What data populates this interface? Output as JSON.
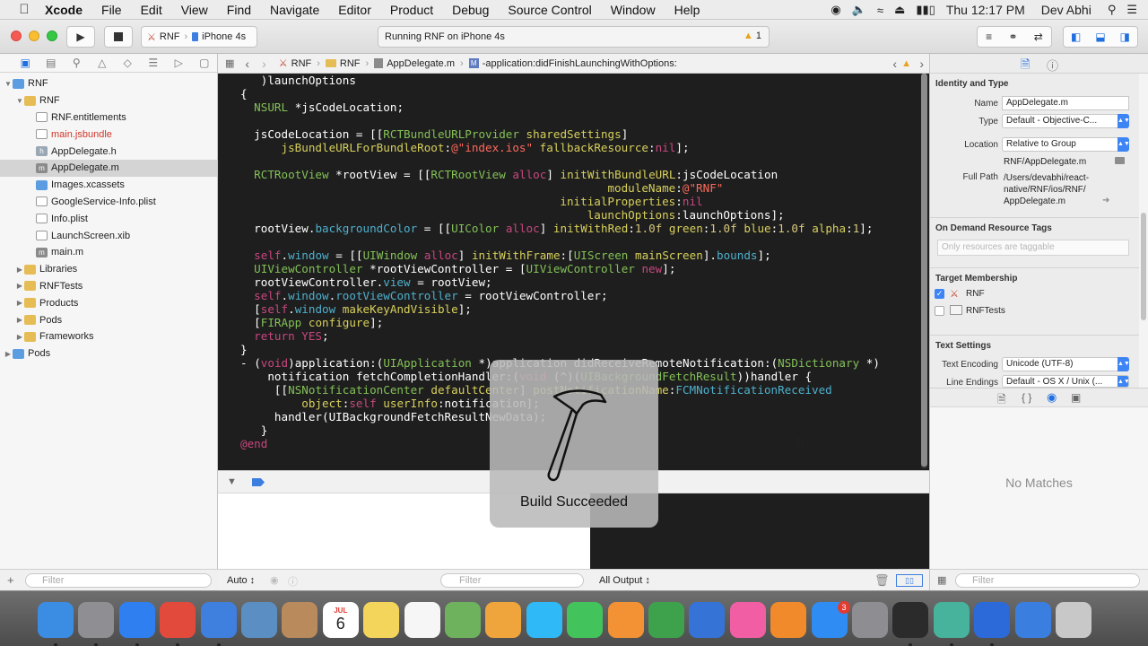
{
  "menubar": {
    "app": "Xcode",
    "items": [
      "File",
      "Edit",
      "View",
      "Find",
      "Navigate",
      "Editor",
      "Product",
      "Debug",
      "Source Control",
      "Window",
      "Help"
    ],
    "clock": "Thu 12:17 PM",
    "user": "Dev Abhi"
  },
  "toolbar": {
    "scheme": "RNF",
    "device": "iPhone 4s",
    "activity": "Running RNF on iPhone 4s",
    "warning_count": "1"
  },
  "navigator": {
    "items": [
      {
        "label": "RNF",
        "depth": 0,
        "icon": "project-icon",
        "expanded": true
      },
      {
        "label": "RNF",
        "depth": 1,
        "icon": "folder-icon",
        "expanded": true
      },
      {
        "label": "RNF.entitlements",
        "depth": 2,
        "icon": "entitlements-file-icon"
      },
      {
        "label": "main.jsbundle",
        "depth": 2,
        "icon": "file-icon",
        "missing": true
      },
      {
        "label": "AppDelegate.h",
        "depth": 2,
        "icon": "header-file-icon"
      },
      {
        "label": "AppDelegate.m",
        "depth": 2,
        "icon": "objc-file-icon",
        "selected": true
      },
      {
        "label": "Images.xcassets",
        "depth": 2,
        "icon": "asset-catalog-icon"
      },
      {
        "label": "GoogleService-Info.plist",
        "depth": 2,
        "icon": "plist-file-icon"
      },
      {
        "label": "Info.plist",
        "depth": 2,
        "icon": "plist-file-icon"
      },
      {
        "label": "LaunchScreen.xib",
        "depth": 2,
        "icon": "xib-file-icon"
      },
      {
        "label": "main.m",
        "depth": 2,
        "icon": "objc-file-icon"
      },
      {
        "label": "Libraries",
        "depth": 1,
        "icon": "folder-icon"
      },
      {
        "label": "RNFTests",
        "depth": 1,
        "icon": "folder-icon"
      },
      {
        "label": "Products",
        "depth": 1,
        "icon": "folder-icon"
      },
      {
        "label": "Pods",
        "depth": 1,
        "icon": "folder-icon"
      },
      {
        "label": "Frameworks",
        "depth": 1,
        "icon": "folder-icon"
      },
      {
        "label": "Pods",
        "depth": 0,
        "icon": "project-icon"
      }
    ],
    "filter_placeholder": "Filter"
  },
  "jumpbar": {
    "segments": [
      "RNF",
      "RNF",
      "AppDelegate.m",
      "-application:didFinishLaunchingWithOptions:"
    ]
  },
  "editor": {
    "lines": [
      "   )launchOptions",
      "{",
      "  NSURL *jsCodeLocation;",
      "",
      "  jsCodeLocation = [[RCTBundleURLProvider sharedSettings]",
      "      jsBundleURLForBundleRoot:@\"index.ios\" fallbackResource:nil];",
      "",
      "  RCTRootView *rootView = [[RCTRootView alloc] initWithBundleURL:jsCodeLocation",
      "                                                      moduleName:@\"RNF\"",
      "                                               initialProperties:nil",
      "                                                   launchOptions:launchOptions];",
      "  rootView.backgroundColor = [[UIColor alloc] initWithRed:1.0f green:1.0f blue:1.0f alpha:1];",
      "",
      "  self.window = [[UIWindow alloc] initWithFrame:[UIScreen mainScreen].bounds];",
      "  UIViewController *rootViewController = [UIViewController new];",
      "  rootViewController.view = rootView;",
      "  self.window.rootViewController = rootViewController;",
      "  [self.window makeKeyAndVisible];",
      "  [FIRApp configure];",
      "  return YES;",
      "}",
      "- (void)application:(UIApplication *)application didReceiveRemoteNotification:(NSDictionary *)",
      "    notification fetchCompletionHandler:(void (^)(UIBackgroundFetchResult))handler {",
      "     [[NSNotificationCenter defaultCenter] postNotificationName:FCMNotificationReceived",
      "         object:self userInfo:notification];",
      "     handler(UIBackgroundFetchResultNewData);",
      "   }",
      "@end"
    ]
  },
  "debug": {
    "auto_label": "Auto ↕",
    "filter_placeholder": "Filter",
    "output_label": "All Output ↕"
  },
  "inspector": {
    "identity_title": "Identity and Type",
    "name_label": "Name",
    "name_value": "AppDelegate.m",
    "type_label": "Type",
    "type_value": "Default - Objective-C...",
    "location_label": "Location",
    "location_value": "Relative to Group",
    "location_path": "RNF/AppDelegate.m",
    "fullpath_label": "Full Path",
    "fullpath_lines": [
      "/Users/devabhi/react-",
      "native/RNF/ios/RNF/",
      "AppDelegate.m"
    ],
    "ondemand_title": "On Demand Resource Tags",
    "ondemand_placeholder": "Only resources are taggable",
    "membership_title": "Target Membership",
    "targets": [
      {
        "name": "RNF",
        "checked": true
      },
      {
        "name": "RNFTests",
        "checked": false
      }
    ],
    "textsettings_title": "Text Settings",
    "encoding_label": "Text Encoding",
    "encoding_value": "Unicode (UTF-8)",
    "lineendings_label": "Line Endings",
    "lineendings_value": "Default - OS X / Unix (...",
    "no_matches": "No Matches",
    "filter_placeholder": "Filter"
  },
  "hud": {
    "message": "Build Succeeded"
  },
  "dock": {
    "apps": [
      "Finder",
      "Launchpad",
      "Safari",
      "Chrome",
      "Xcode",
      "Preview",
      "Contacts",
      "Calendar",
      "Notes",
      "Reminders",
      "Maps",
      "Photos",
      "Messages",
      "FaceTime",
      "Pages",
      "Numbers",
      "Keynote",
      "iTunes",
      "iBooks",
      "App Store",
      "System Preferences",
      "Terminal",
      "Atom",
      "QuickTime",
      "Xcode Tool",
      "Trash"
    ],
    "calendar_month": "JUL",
    "calendar_day": "6",
    "appstore_badge": "3"
  },
  "colors": {
    "editor_bg": "#1e1e1e",
    "keyword": "#c8477f",
    "type": "#83c057",
    "string": "#fc6a5d",
    "number": "#d9c97c",
    "accent": "#1f6fe0"
  }
}
